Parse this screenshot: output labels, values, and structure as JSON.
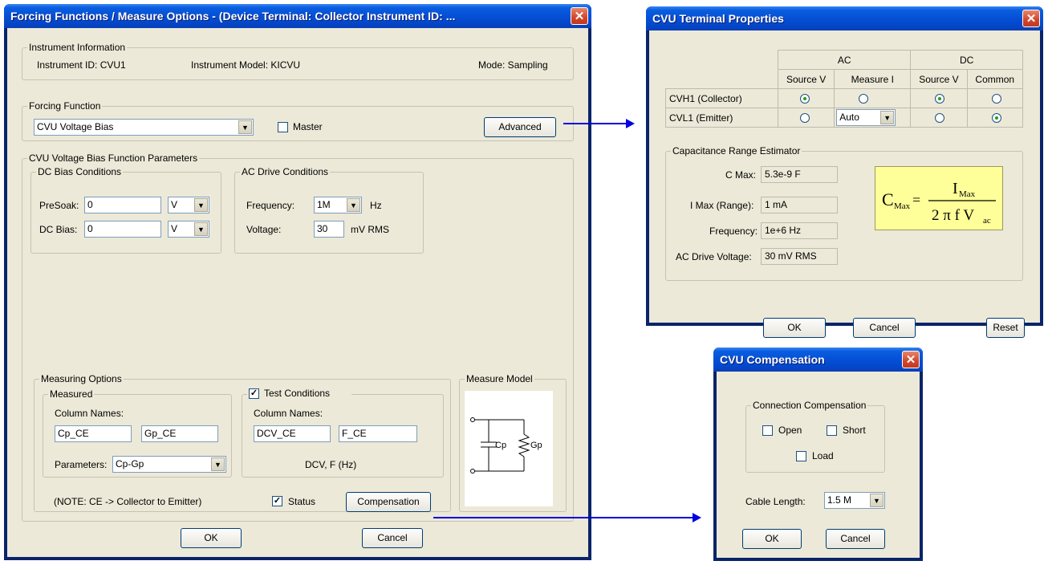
{
  "main_dialog": {
    "title": "Forcing Functions / Measure Options - (Device Terminal: Collector  Instrument ID: ...",
    "instrument_info": {
      "group_title": "Instrument Information",
      "instrument_id": "Instrument ID:  CVU1",
      "instrument_model": "Instrument Model:  KICVU",
      "mode": "Mode:  Sampling"
    },
    "forcing_function": {
      "group_title": "Forcing Function",
      "selected": "CVU Voltage Bias",
      "master_label": "Master",
      "advanced_label": "Advanced"
    },
    "params": {
      "group_title": "CVU Voltage Bias Function Parameters",
      "dc_bias": {
        "group_title": "DC Bias Conditions",
        "presoak_label": "PreSoak:",
        "presoak_value": "0",
        "presoak_unit": "V",
        "dcbias_label": "DC Bias:",
        "dcbias_value": "0",
        "dcbias_unit": "V"
      },
      "ac_drive": {
        "group_title": "AC Drive Conditions",
        "frequency_label": "Frequency:",
        "frequency_value": "1M",
        "frequency_unit": "Hz",
        "voltage_label": "Voltage:",
        "voltage_value": "30",
        "voltage_unit": "mV RMS"
      }
    },
    "measuring_options": {
      "group_title": "Measuring Options",
      "measured": {
        "group_title": "Measured",
        "column_names_label": "Column Names:",
        "col1": "Cp_CE",
        "col2": "Gp_CE",
        "parameters_label": "Parameters:",
        "parameters_value": "Cp-Gp"
      },
      "test_conditions": {
        "label": "Test Conditions",
        "column_names_label": "Column Names:",
        "col1": "DCV_CE",
        "col2": "F_CE",
        "summary": "DCV, F (Hz)"
      },
      "note": "(NOTE: CE -> Collector to Emitter)",
      "status_label": "Status",
      "compensation_label": "Compensation"
    },
    "measure_model": {
      "group_title": "Measure Model",
      "cp": "Cp",
      "gp": "Gp"
    },
    "ok_label": "OK",
    "cancel_label": "Cancel"
  },
  "terminal_dialog": {
    "title": "CVU Terminal Properties",
    "ac_header": "AC",
    "dc_header": "DC",
    "sub_headers": [
      "Source V",
      "Measure I",
      "Source V",
      "Common"
    ],
    "rows": [
      {
        "label": "CVH1 (Collector)"
      },
      {
        "label": "CVL1 (Emitter)",
        "measure_i": "Auto"
      }
    ],
    "estimator": {
      "group_title": "Capacitance Range Estimator",
      "cmax_label": "C Max:",
      "cmax_value": "5.3e-9 F",
      "imax_label": "I Max (Range):",
      "imax_value": "1 mA",
      "freq_label": "Frequency:",
      "freq_value": "1e+6 Hz",
      "acv_label": "AC Drive Voltage:",
      "acv_value": "30 mV RMS"
    },
    "ok_label": "OK",
    "cancel_label": "Cancel",
    "reset_label": "Reset"
  },
  "compensation_dialog": {
    "title": "CVU Compensation",
    "group_title": "Connection Compensation",
    "open_label": "Open",
    "short_label": "Short",
    "load_label": "Load",
    "cable_length_label": "Cable Length:",
    "cable_length_value": "1.5 M",
    "ok_label": "OK",
    "cancel_label": "Cancel"
  }
}
